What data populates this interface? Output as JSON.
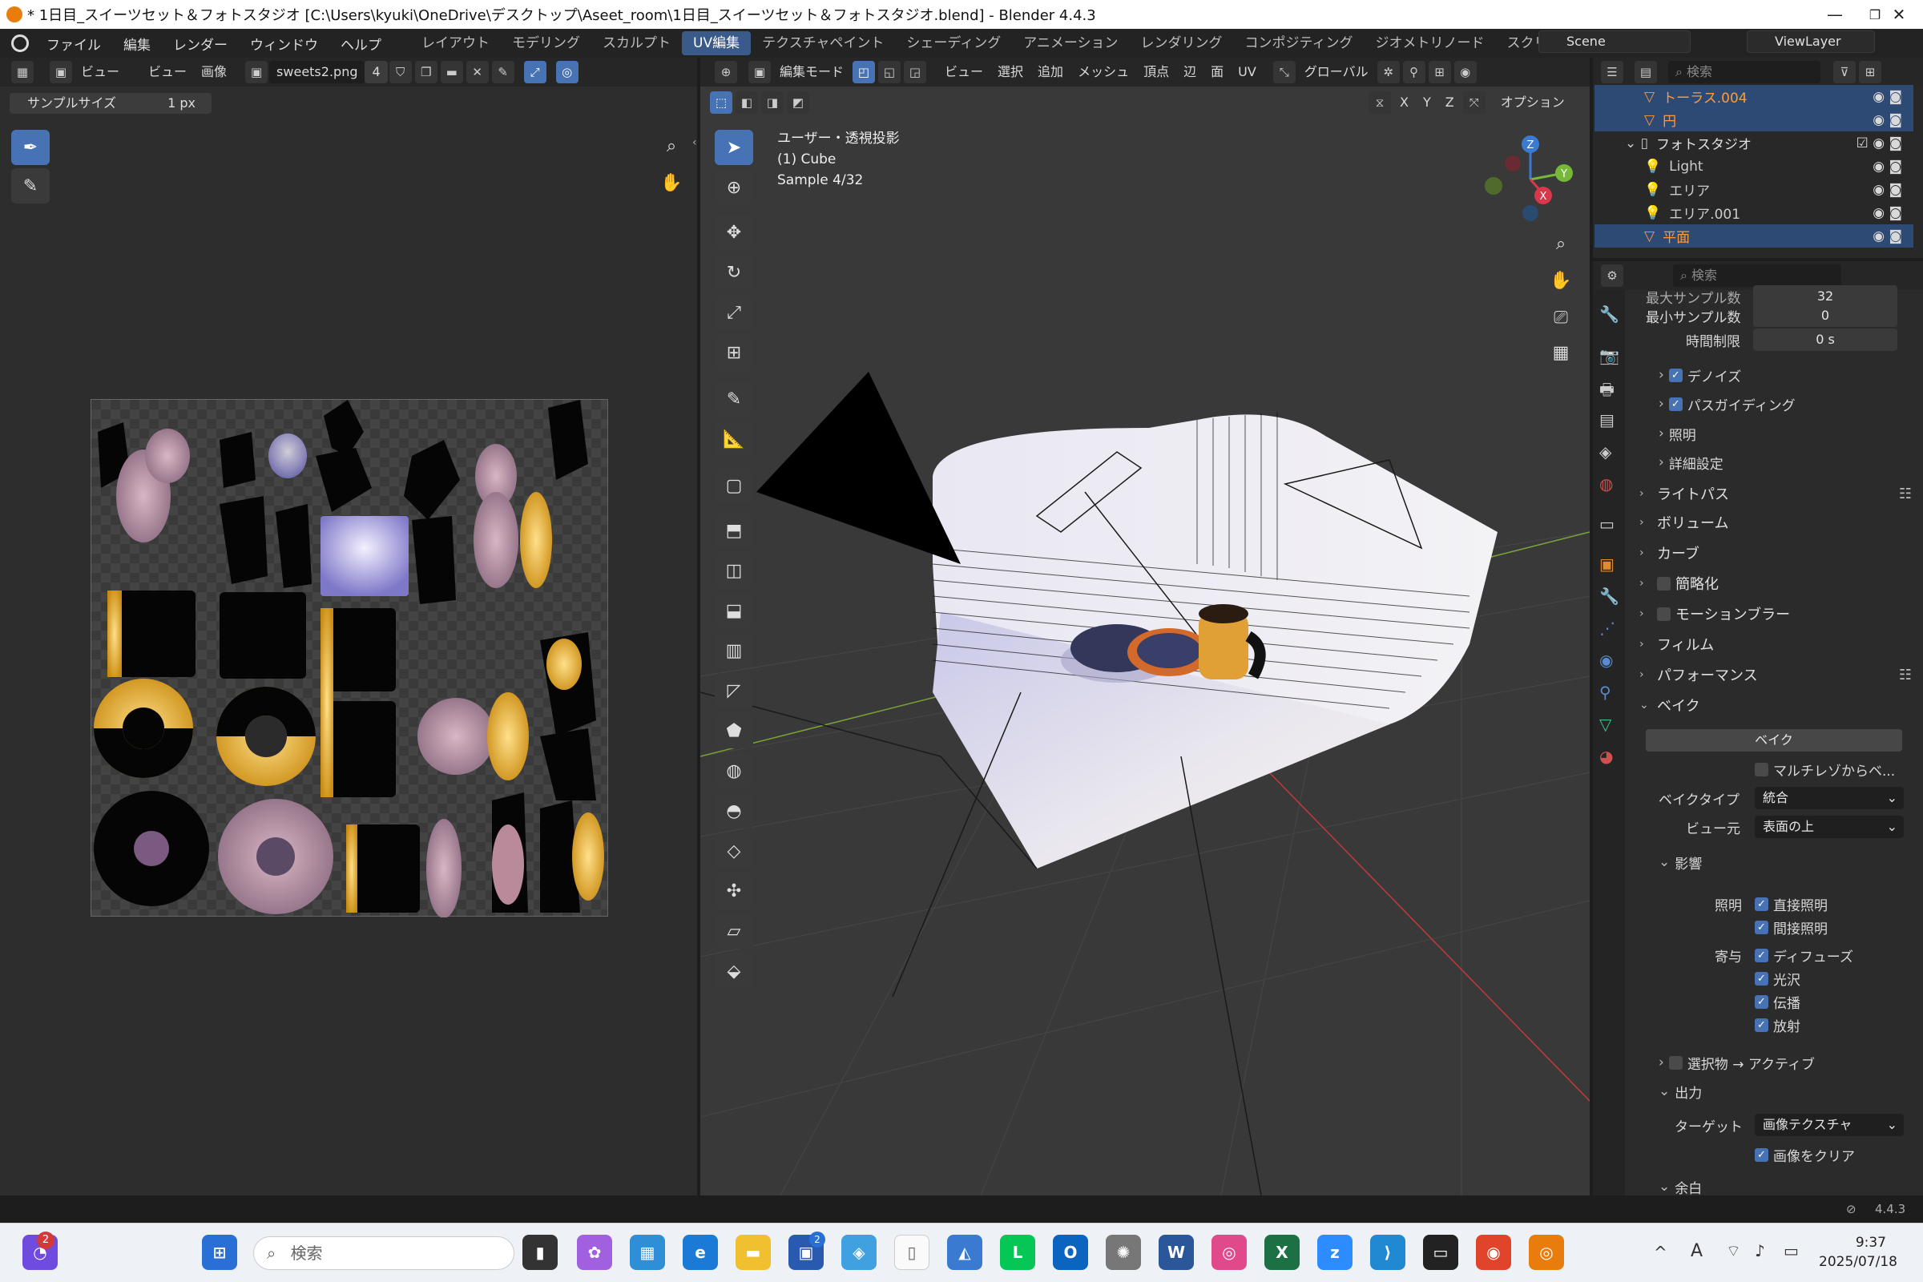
{
  "window": {
    "title": "* 1日目_スイーツセット＆フォトスタジオ [C:\\Users\\kyuki\\OneDrive\\デスクトップ\\Aseet_room\\1日目_スイーツセット＆フォトスタジオ.blend] - Blender 4.4.3",
    "minimize": "—",
    "maximize": "❐",
    "close": "✕"
  },
  "menubar": {
    "items": [
      "ファイル",
      "編集",
      "レンダー",
      "ウィンドウ",
      "ヘルプ"
    ],
    "workspaces": [
      "レイアウト",
      "モデリング",
      "スカルプト",
      "UV編集",
      "テクスチャペイント",
      "シェーディング",
      "アニメーション",
      "レンダリング",
      "コンポジティング",
      "ジオメトリノード",
      "スクリ"
    ],
    "active_workspace": "UV編集",
    "scene": "Scene",
    "view_layer": "ViewLayer"
  },
  "image_editor": {
    "header": {
      "view": "ビュー",
      "view2": "ビュー",
      "image": "画像",
      "image_name": "sweets2.png",
      "users": "4"
    },
    "sample_label": "サンプルサイズ",
    "sample_value": "1 px"
  },
  "viewport": {
    "header": {
      "mode": "編集モード",
      "menus": [
        "ビュー",
        "選択",
        "追加",
        "メッシュ",
        "頂点",
        "辺",
        "面",
        "UV"
      ],
      "transform": "グローバル",
      "options": "オプション"
    },
    "axes": [
      "X",
      "Y",
      "Z"
    ],
    "overlay": {
      "line1": "ユーザー・透視投影",
      "line2": "(1) Cube",
      "line3": "Sample 4/32"
    },
    "gizmo": {
      "x": "X",
      "y": "Y",
      "z": "Z"
    }
  },
  "outliner": {
    "search_placeholder": "検索",
    "rows": [
      {
        "name": "トーラス.004",
        "selected": true,
        "indent": 1
      },
      {
        "name": "円",
        "selected": true,
        "indent": 1
      },
      {
        "name": "フォトスタジオ",
        "selected": false,
        "indent": 0
      },
      {
        "name": "Light",
        "selected": false,
        "indent": 1
      },
      {
        "name": "エリア",
        "selected": false,
        "indent": 1
      },
      {
        "name": "エリア.001",
        "selected": false,
        "indent": 1
      },
      {
        "name": "平面",
        "selected": true,
        "indent": 1
      }
    ]
  },
  "properties": {
    "search_placeholder": "検索",
    "max_samples_label": "最大サンプル数",
    "max_samples": "32",
    "min_samples_label": "最小サンプル数",
    "min_samples": "0",
    "time_limit_label": "時間制限",
    "time_limit": "0 s",
    "subsections": [
      "デノイズ",
      "パスガイディング",
      "照明",
      "詳細設定"
    ],
    "sections": [
      "ライトパス",
      "ボリューム",
      "カーブ",
      "簡略化",
      "モーションブラー",
      "フィルム",
      "パフォーマンス",
      "ベイク"
    ],
    "bake_button": "ベイク",
    "multires": "マルチレゾからベ...",
    "bake_type_label": "ベイクタイプ",
    "bake_type": "統合",
    "view_from_label": "ビュー元",
    "view_from": "表面の上",
    "influence": "影響",
    "lighting_label": "照明",
    "direct": "直接照明",
    "indirect": "間接照明",
    "contrib_label": "寄与",
    "diffuse": "ディフューズ",
    "glossy": "光沢",
    "transmission": "伝播",
    "emit": "放射",
    "selected_to_active": "選択物 → アクティブ",
    "output": "出力",
    "target_label": "ターゲット",
    "target": "画像テクスチャ",
    "clear_image": "画像をクリア",
    "margin": "余白"
  },
  "statusbar": {
    "version": "4.4.3"
  },
  "taskbar": {
    "search_placeholder": "検索",
    "time": "9:37",
    "date": "2025/07/18",
    "notification_badge": "2",
    "store_badge": "2"
  }
}
